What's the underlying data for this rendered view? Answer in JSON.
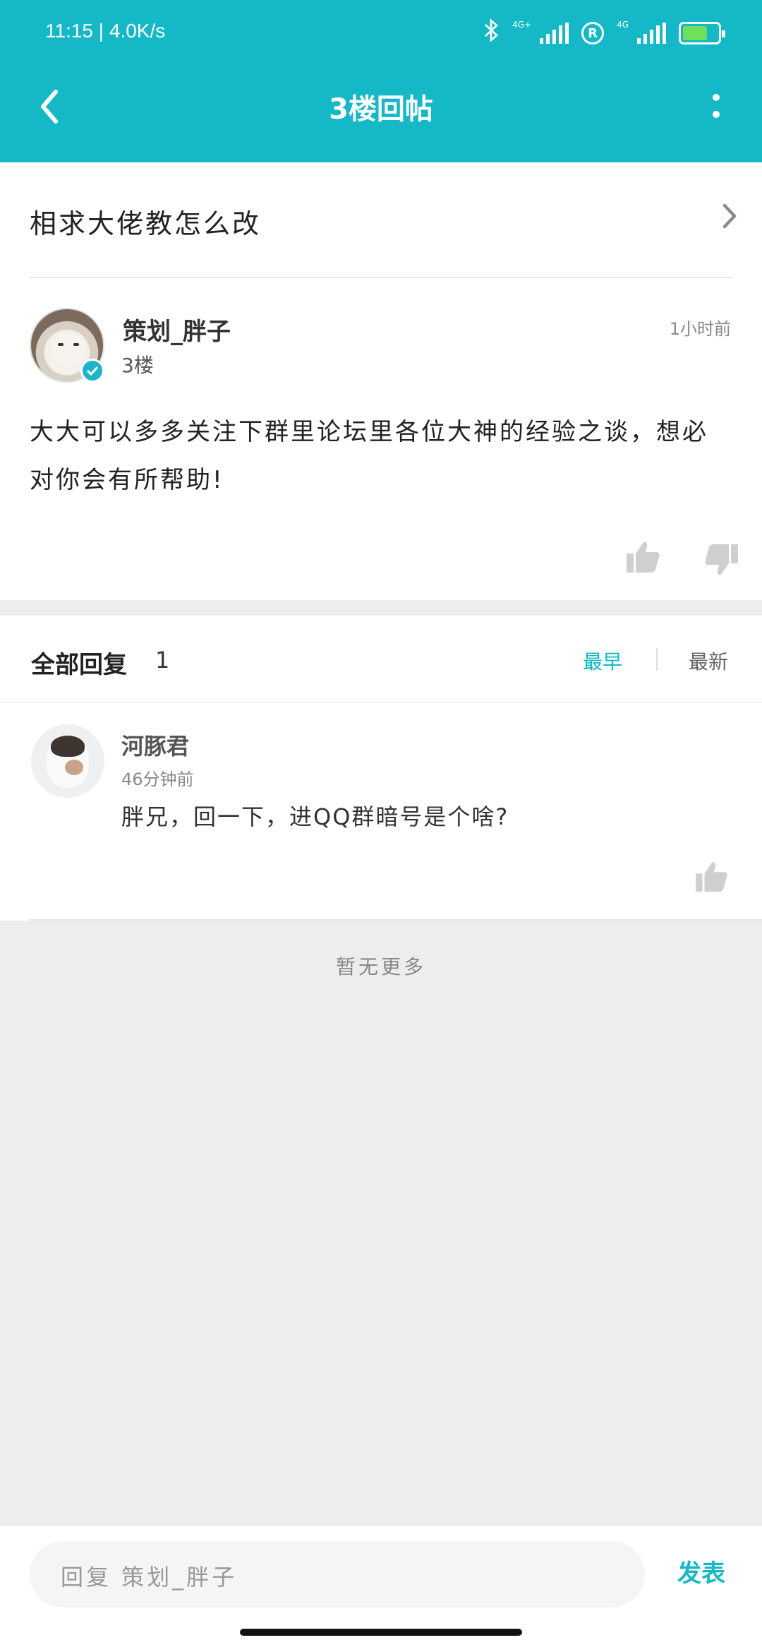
{
  "status_bar": {
    "time": "11:15",
    "speed": "4.0K/s",
    "net1": "4G+",
    "net2": "4G",
    "icons": [
      "bluetooth-icon",
      "signal-icon",
      "roaming-icon",
      "signal-icon",
      "battery-icon"
    ]
  },
  "header": {
    "title": "3楼回帖",
    "back_icon": "back-arrow-icon",
    "more_icon": "more-vertical-icon"
  },
  "thread": {
    "title": "相求大佬教怎么改"
  },
  "post": {
    "author": "策划_胖子",
    "floor": "3楼",
    "time": "1小时前",
    "content": "大大可以多多关注下群里论坛里各位大神的经验之谈，想必对你会有所帮助!"
  },
  "replies": {
    "label": "全部回复",
    "count": "1",
    "sort_early": "最早",
    "sort_new": "最新",
    "items": [
      {
        "author": "河豚君",
        "time": "46分钟前",
        "content": "胖兄，回一下，进QQ群暗号是个啥?"
      }
    ]
  },
  "no_more": "暂无更多",
  "bottom_bar": {
    "placeholder": "回复 策划_胖子",
    "send": "发表"
  },
  "colors": {
    "accent": "#14b8c6",
    "background": "#ededed"
  }
}
